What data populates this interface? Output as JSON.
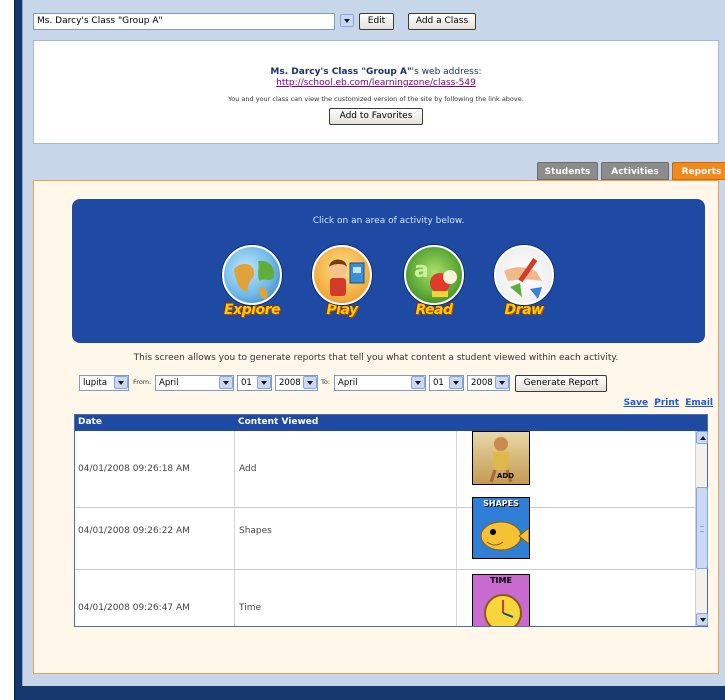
{
  "class_selector": {
    "selected": "Ms. Darcy's Class \"Group A\"",
    "edit_label": "Edit",
    "add_class_label": "Add a Class"
  },
  "info": {
    "title_bold": "Ms. Darcy's Class \"Group A\"",
    "title_suffix": "'s web address:",
    "url": "http://school.eb.com/learningzone/class-549",
    "note": "You and your class can view the customized version of the site by following the link above.",
    "favorites_label": "Add to Favorites"
  },
  "tabs": [
    {
      "label": "Students",
      "active": false
    },
    {
      "label": "Activities",
      "active": false
    },
    {
      "label": "Reports",
      "active": true
    }
  ],
  "activities": {
    "prompt": "Click on an area of activity below.",
    "items": [
      {
        "label": "Explore",
        "icon": "globe-icon"
      },
      {
        "label": "Play",
        "icon": "child-playing-icon"
      },
      {
        "label": "Read",
        "icon": "letters-icon"
      },
      {
        "label": "Draw",
        "icon": "drawing-hand-icon"
      }
    ]
  },
  "description": "This screen allows you to generate reports that tell you what content a student viewed within each activity.",
  "filters": {
    "student": "lupita",
    "from_label": "From:",
    "from_month": "April",
    "from_day": "01",
    "from_year": "2008",
    "to_label": "To:",
    "to_month": "April",
    "to_day": "01",
    "to_year": "2008",
    "generate_label": "Generate Report"
  },
  "links": {
    "save": "Save",
    "print": "Print",
    "email": "Email"
  },
  "report": {
    "columns": [
      "Date",
      "Content Viewed"
    ],
    "rows": [
      {
        "date": "04/01/2008 09:26:18 AM",
        "content": "Add",
        "thumb_label": "ADD"
      },
      {
        "date": "04/01/2008 09:26:22 AM",
        "content": "Shapes",
        "thumb_label": "SHAPES"
      },
      {
        "date": "04/01/2008 09:26:47 AM",
        "content": "Time",
        "thumb_label": "TIME"
      }
    ]
  },
  "colors": {
    "frame": "#14376e",
    "panel": "#c8d6ea",
    "active_tab": "#f08a1c",
    "activity_box": "#1f4aa3",
    "link": "#1a5bd8"
  }
}
